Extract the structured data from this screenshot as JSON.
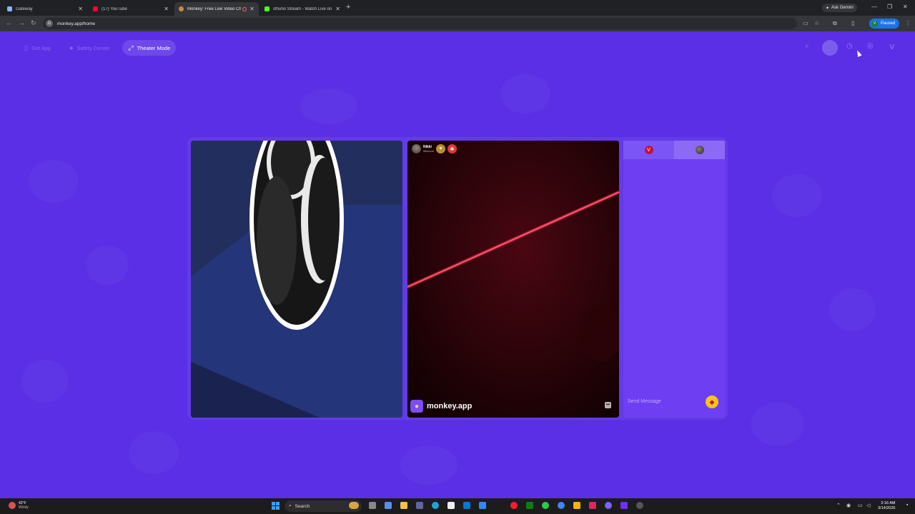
{
  "browser": {
    "tabs": [
      {
        "title": "Gateway",
        "active": false
      },
      {
        "title": "(17) YouTube",
        "active": false
      },
      {
        "title": "Monkey: Free Live Video Chat",
        "active": true
      },
      {
        "title": "sthuho Stream - Watch Live on",
        "active": false
      }
    ],
    "ask_gemini": "Ask Gemini",
    "url": "monkey.app/home",
    "profile_status": "Paused",
    "profile_initial": "V"
  },
  "page": {
    "nav": {
      "get_app": "Get App",
      "safety_center": "Safety Center",
      "theater_mode": "Theater Mode"
    },
    "user_initial": "V",
    "remote_user": {
      "name": "Nikki",
      "location": "Missouri"
    },
    "brand": "monkey.app",
    "chat": {
      "self_initial": "V",
      "input_placeholder": "Send Message"
    }
  },
  "taskbar": {
    "weather_temp": "42°F",
    "weather_desc": "Windy",
    "search_label": "Search",
    "time": "3:16 AM",
    "date": "3/14/2026"
  },
  "colors": {
    "page_bg": "#5a2fe6",
    "chat_bg": "#6e3ef2",
    "accent_red": "#c0133f",
    "gift_yellow": "#f5c518"
  }
}
